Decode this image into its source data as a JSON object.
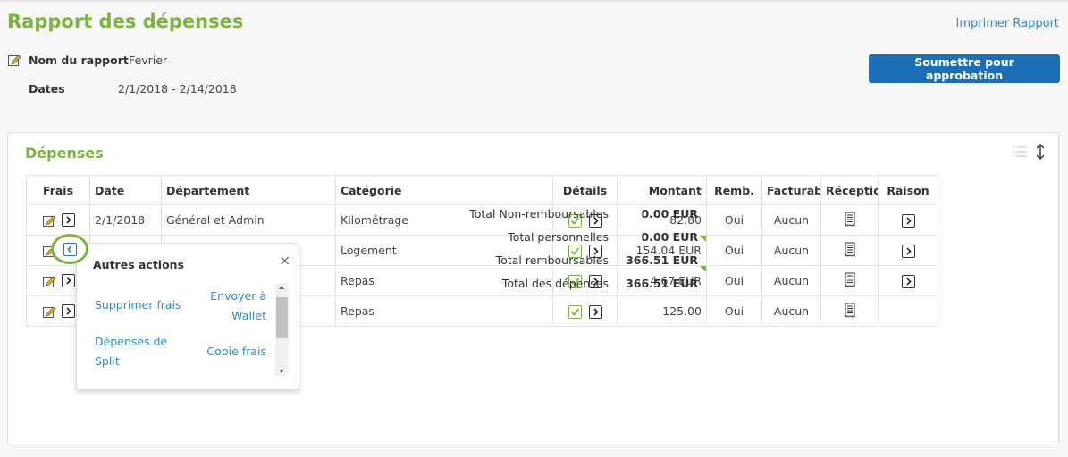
{
  "header": {
    "title": "Rapport des dépenses",
    "print_link": "Imprimer Rapport",
    "submit_button": "Soumettre pour approbation"
  },
  "report": {
    "name_label": "Nom du rapport",
    "name_value": "Fevrier",
    "dates_label": "Dates",
    "dates_value": "2/1/2018 - 2/14/2018"
  },
  "expenses": {
    "title": "Dépenses",
    "columns": [
      "Frais",
      "Date",
      "Département",
      "Catégorie",
      "Détails",
      "Montant",
      "Remb.",
      "Facturabl",
      "Réception",
      "Raison"
    ],
    "rows": [
      {
        "date": "2/1/2018",
        "department": "Général et Admin",
        "category": "Kilométrage",
        "amount": "82.80",
        "remb": "Oui",
        "billable": "Aucun",
        "has_reason": true,
        "flag": false
      },
      {
        "date": "",
        "department": "",
        "category": "Logement",
        "amount": "154.04 EUR",
        "remb": "Oui",
        "billable": "Aucun",
        "has_reason": true,
        "flag": true
      },
      {
        "date": "",
        "department": "",
        "category": "Repas",
        "amount": "4.67 EUR",
        "remb": "Oui",
        "billable": "Aucun",
        "has_reason": true,
        "flag": true
      },
      {
        "date": "",
        "department": "",
        "category": "Repas",
        "amount": "125.00",
        "remb": "Oui",
        "billable": "Aucun",
        "has_reason": false,
        "flag": false
      }
    ]
  },
  "totals": [
    {
      "label": "Total Non-remboursables",
      "value": "0.00 EUR"
    },
    {
      "label": "Total personnelles",
      "value": "0.00 EUR"
    },
    {
      "label": "Total remboursables",
      "value": "366.51 EUR"
    },
    {
      "label": "Total des dépenses",
      "value": "366.51 EUR"
    }
  ],
  "popover": {
    "title": "Autres actions",
    "close": "×",
    "actions": [
      "Supprimer frais",
      "Envoyer à Wallet",
      "Dépenses de Split",
      "Copie frais"
    ]
  },
  "colors": {
    "accent_green": "#7cb342",
    "link_blue": "#2a8bcf",
    "button_blue": "#1a6fb7"
  },
  "icons": [
    "pencil-icon",
    "edit-icon",
    "expand-icon",
    "collapse-icon",
    "check-icon",
    "receipt-icon",
    "list-icon",
    "sort-icon",
    "close-icon"
  ]
}
